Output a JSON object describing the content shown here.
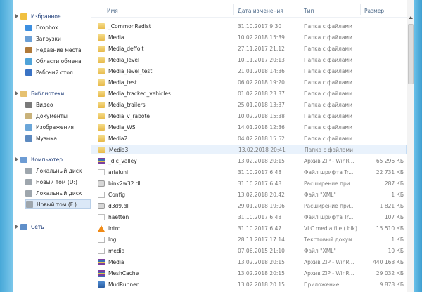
{
  "columns": {
    "name": "Имя",
    "date": "Дата изменения",
    "type": "Тип",
    "size": "Размер"
  },
  "nav": {
    "favorites": {
      "label": "Избранное",
      "items": [
        {
          "label": "Dropbox",
          "icon": "dropbox-icon"
        },
        {
          "label": "Загрузки",
          "icon": "downloads-folder-icon"
        },
        {
          "label": "Недавние места",
          "icon": "recent-places-icon"
        },
        {
          "label": "Области обмена",
          "icon": "sharing-icon"
        },
        {
          "label": "Рабочий стол",
          "icon": "desktop-icon"
        }
      ]
    },
    "libraries": {
      "label": "Библиотеки",
      "items": [
        {
          "label": "Видео",
          "icon": "video-library-icon"
        },
        {
          "label": "Документы",
          "icon": "documents-library-icon"
        },
        {
          "label": "Изображения",
          "icon": "pictures-library-icon"
        },
        {
          "label": "Музыка",
          "icon": "music-library-icon"
        }
      ]
    },
    "computer": {
      "label": "Компьютер",
      "items": [
        {
          "label": "Локальный диск",
          "icon": "drive-icon"
        },
        {
          "label": "Новый том (D:)",
          "icon": "drive-icon"
        },
        {
          "label": "Локальный диск",
          "icon": "drive-icon"
        },
        {
          "label": "Новый том (F:)",
          "icon": "drive-icon"
        }
      ]
    },
    "network": {
      "label": "Сеть"
    }
  },
  "files": [
    {
      "name": "_CommonRedist",
      "date": "31.10.2017 9:30",
      "type": "Папка с файлами",
      "size": "",
      "icon": "folder"
    },
    {
      "name": "Media",
      "date": "10.02.2018 15:39",
      "type": "Папка с файлами",
      "size": "",
      "icon": "folder"
    },
    {
      "name": "Media_deffolt",
      "date": "27.11.2017 21:12",
      "type": "Папка с файлами",
      "size": "",
      "icon": "folder"
    },
    {
      "name": "Media_level",
      "date": "10.11.2017 20:13",
      "type": "Папка с файлами",
      "size": "",
      "icon": "folder"
    },
    {
      "name": "Media_level_test",
      "date": "21.01.2018 14:36",
      "type": "Папка с файлами",
      "size": "",
      "icon": "folder"
    },
    {
      "name": "Media_test",
      "date": "06.02.2018 19:20",
      "type": "Папка с файлами",
      "size": "",
      "icon": "folder"
    },
    {
      "name": "Media_tracked_vehicles",
      "date": "01.02.2018 23:37",
      "type": "Папка с файлами",
      "size": "",
      "icon": "folder"
    },
    {
      "name": "Media_trailers",
      "date": "25.01.2018 13:37",
      "type": "Папка с файлами",
      "size": "",
      "icon": "folder"
    },
    {
      "name": "Media_v_rabote",
      "date": "10.02.2018 15:38",
      "type": "Папка с файлами",
      "size": "",
      "icon": "folder"
    },
    {
      "name": "Media_WS",
      "date": "14.01.2018 12:36",
      "type": "Папка с файлами",
      "size": "",
      "icon": "folder"
    },
    {
      "name": "Media2",
      "date": "04.02.2018 15:52",
      "type": "Папка с файлами",
      "size": "",
      "icon": "folder"
    },
    {
      "name": "Media3",
      "date": "13.02.2018 20:41",
      "type": "Папка с файлами",
      "size": "",
      "icon": "folder",
      "selected": true
    },
    {
      "name": "_dlc_valley",
      "date": "13.02.2018 20:15",
      "type": "Архив ZIP - WinR...",
      "size": "65 296 КБ",
      "icon": "zip"
    },
    {
      "name": "arialuni",
      "date": "31.10.2017 6:48",
      "type": "Файл шрифта Tr...",
      "size": "22 731 КБ",
      "icon": "font"
    },
    {
      "name": "bink2w32.dll",
      "date": "31.10.2017 6:48",
      "type": "Расширение при...",
      "size": "287 КБ",
      "icon": "gear"
    },
    {
      "name": "Config",
      "date": "13.02.2018 20:42",
      "type": "Файл \"XML\"",
      "size": "1 КБ",
      "icon": "doc"
    },
    {
      "name": "d3d9.dll",
      "date": "29.01.2018 19:06",
      "type": "Расширение при...",
      "size": "1 821 КБ",
      "icon": "gear"
    },
    {
      "name": "haetten",
      "date": "31.10.2017 6:48",
      "type": "Файл шрифта Tr...",
      "size": "107 КБ",
      "icon": "font"
    },
    {
      "name": "intro",
      "date": "31.10.2017 6:47",
      "type": "VLC media file (.bik)",
      "size": "15 510 КБ",
      "icon": "vlc"
    },
    {
      "name": "log",
      "date": "28.11.2017 17:14",
      "type": "Текстовый докум...",
      "size": "1 КБ",
      "icon": "doc"
    },
    {
      "name": "media",
      "date": "07.06.2015 21:10",
      "type": "Файл \"XML\"",
      "size": "10 КБ",
      "icon": "doc"
    },
    {
      "name": "Media",
      "date": "13.02.2018 20:15",
      "type": "Архив ZIP - WinR...",
      "size": "440 168 КБ",
      "icon": "zip"
    },
    {
      "name": "MeshCache",
      "date": "13.02.2018 20:15",
      "type": "Архив ZIP - WinR...",
      "size": "29 032 КБ",
      "icon": "zip"
    },
    {
      "name": "MudRunner",
      "date": "13.02.2018 20:15",
      "type": "Приложение",
      "size": "9 878 КБ",
      "icon": "app"
    }
  ]
}
